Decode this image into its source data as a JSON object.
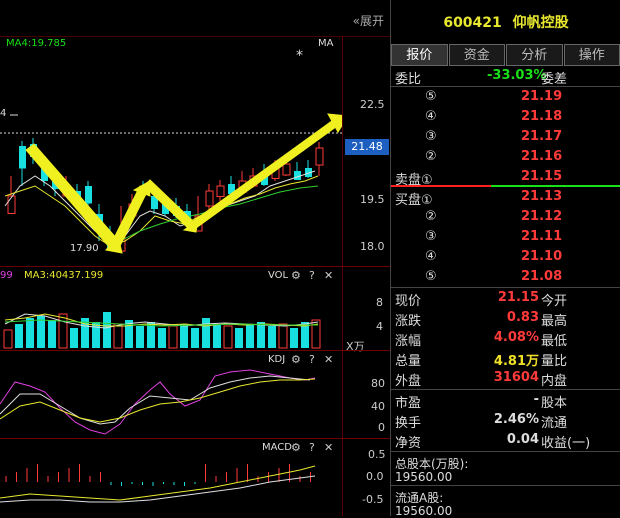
{
  "toolbar": {
    "expand_label": "«展开"
  },
  "kline": {
    "ma_label": "MA4:19.785",
    "ma_tag": "MA",
    "star": "*",
    "y_ticks": [
      "22.5",
      "21.48",
      "19.5",
      "18.0"
    ],
    "low_label": "17.90",
    "marker_label": "4",
    "current_price_badge": "21.48"
  },
  "vol": {
    "prefix": "99",
    "ma3_label": "MA3:40437.199",
    "title": "VOL",
    "y_ticks": [
      "8",
      "4"
    ],
    "unit": "X万"
  },
  "kdj": {
    "title": "KDJ",
    "y_ticks": [
      "80",
      "40",
      "0"
    ]
  },
  "macd": {
    "title": "MACD",
    "y_ticks": [
      "0.5",
      "0.0",
      "-0.5"
    ]
  },
  "stock": {
    "code": "600421",
    "name": "仰帆控股",
    "tabs": [
      "报价",
      "资金",
      "分析",
      "操作"
    ],
    "weibi_label": "委比",
    "weibi_value": "-33.03%",
    "weicha_label": "委差",
    "sell": [
      {
        "label": "⑤",
        "price": "21.19"
      },
      {
        "label": "④",
        "price": "21.18"
      },
      {
        "label": "③",
        "price": "21.17"
      },
      {
        "label": "②",
        "price": "21.16"
      },
      {
        "label": "卖盘①",
        "price": "21.15"
      }
    ],
    "buy": [
      {
        "label": "买盘①",
        "price": "21.13"
      },
      {
        "label": "②",
        "price": "21.12"
      },
      {
        "label": "③",
        "price": "21.11"
      },
      {
        "label": "④",
        "price": "21.10"
      },
      {
        "label": "⑤",
        "price": "21.08"
      }
    ],
    "quote": [
      {
        "l": "现价",
        "v": "21.15",
        "r": "今开",
        "vc": "red"
      },
      {
        "l": "涨跌",
        "v": "0.83",
        "r": "最高",
        "vc": "red"
      },
      {
        "l": "涨幅",
        "v": "4.08%",
        "r": "最低",
        "vc": "red"
      },
      {
        "l": "总量",
        "v": "4.81万",
        "r": "量比",
        "vc": "yellow"
      },
      {
        "l": "外盘",
        "v": "31604",
        "r": "内盘",
        "vc": "red"
      }
    ],
    "finance": [
      {
        "l": "市盈",
        "v": "-",
        "r": "股本"
      },
      {
        "l": "换手",
        "v": "2.46%",
        "r": "流通"
      },
      {
        "l": "净资",
        "v": "0.04",
        "r": "收益(一)"
      }
    ],
    "total_shares_label": "总股本(万股):",
    "total_shares_value": "19560.00",
    "float_a_label": "流通A股:",
    "float_a_value": "19560.00"
  },
  "colors": {
    "up": "#ff3a3a",
    "down": "#19e0e0",
    "arrow": "#f0f020"
  }
}
